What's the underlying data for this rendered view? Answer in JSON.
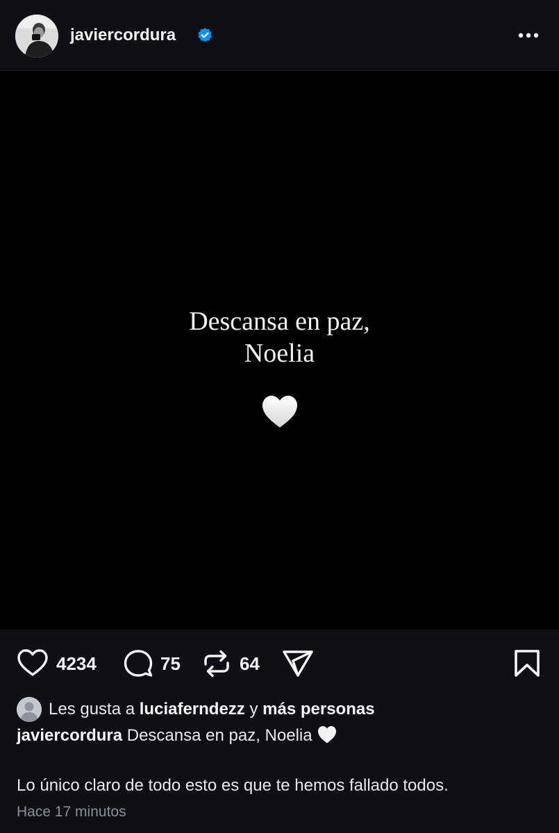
{
  "header": {
    "username": "javiercordura",
    "verified": true,
    "icons": {
      "avatar": "profile-photo",
      "verified": "verified-badge-icon",
      "more": "more-options-icon"
    }
  },
  "post": {
    "text_line1": "Descansa en paz,",
    "text_line2": "Noelia",
    "emoji": "white-heart"
  },
  "actions": {
    "likes": "4234",
    "comments": "75",
    "reposts": "64",
    "icons": [
      "heart-icon",
      "comment-icon",
      "repost-icon",
      "share-icon",
      "bookmark-icon"
    ]
  },
  "likes_line": {
    "prefix": "Les gusta a",
    "user": "luciaferndezz",
    "connector": "y",
    "others": "más personas"
  },
  "caption": {
    "username": "javiercordura",
    "text": "Descansa en paz, Noelia"
  },
  "comment": {
    "text": "Lo único claro de todo esto es que te hemos fallado todos."
  },
  "timestamp": "Hace 17 minutos",
  "colors": {
    "background": "#0e1015",
    "image_background": "#000000",
    "verified_blue": "#0095f6",
    "text": "#f5f5f5",
    "muted": "#8b8f96"
  }
}
